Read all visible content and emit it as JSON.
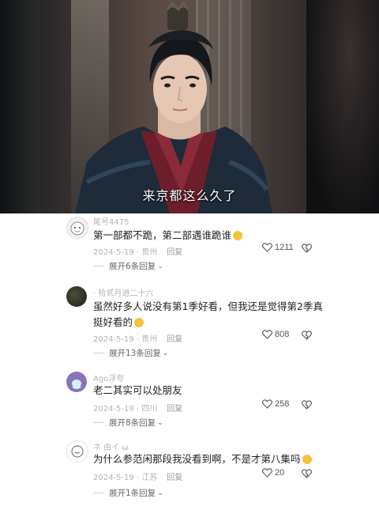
{
  "video": {
    "subtitle": "来京都这么久了"
  },
  "comments": [
    {
      "username": "尾号4475",
      "text": "第一部都不跪，第二部遇谁跪谁",
      "emoji": "laughing-crying-emoji",
      "date_location": "2024-5-19 · 贵州",
      "reply_label": "回复",
      "likes": "1211",
      "expand_label": "展开6条回复"
    },
    {
      "username": "· 拾贰月逍二十六",
      "text": "虽然好多人说没有第1季好看，但我还是觉得第2季真挺好看的",
      "emoji": "smiling-emoji",
      "date_location": "2024-5-19 · 贵州",
      "reply_label": "回复",
      "likes": "808",
      "expand_label": "展开13条回复"
    },
    {
      "username": "Ago浮夸",
      "text": "老二其实可以处朋友",
      "emoji": "",
      "date_location": "2024-5-19 · 四川",
      "reply_label": "回复",
      "likes": "258",
      "expand_label": "展开8条回复"
    },
    {
      "username": "ネ 由イ ω",
      "text": "为什么参范闲那段我没看到啊，不是才第八集吗",
      "emoji": "thinking-emoji",
      "date_location": "2024-5-19 · 江苏",
      "reply_label": "回复",
      "likes": "20",
      "expand_label": "展开1条回复"
    }
  ],
  "colors": {
    "text": "#222222",
    "muted": "#b3b3b3",
    "emoji": "#f6c13b"
  }
}
